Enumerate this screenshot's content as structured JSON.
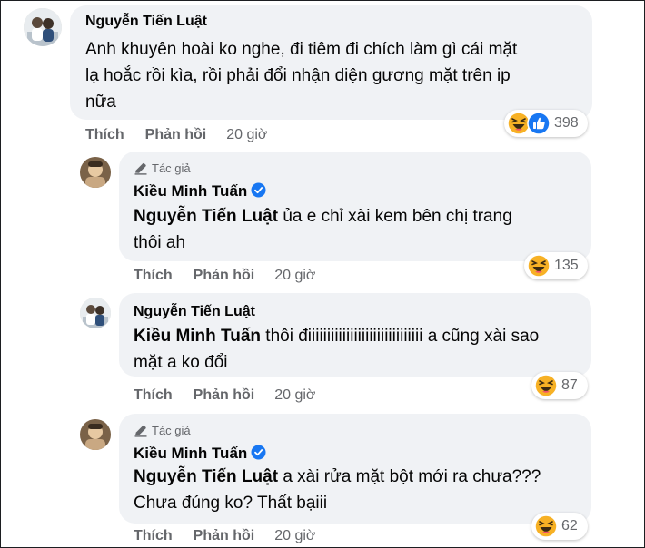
{
  "comments": [
    {
      "author": "Nguyễn Tiến Luật",
      "author_badge": "",
      "verified": false,
      "mention": "",
      "lines": [
        "Anh khuyên hoài ko nghe, đi tiêm đi chích làm gì cái mặt",
        "lạ hoắc rồi kìa, rồi phải đổi nhận diện gương mặt trên ip",
        "nữa"
      ],
      "reactions": [
        "haha-icon",
        "like-icon"
      ],
      "reaction_count": "398",
      "actions": {
        "like": "Thích",
        "reply": "Phản hồi",
        "time": "20 giờ"
      }
    },
    {
      "author": "Kiều Minh Tuấn",
      "author_badge": "Tác giả",
      "verified": true,
      "mention": "Nguyễn Tiến Luật",
      "lines": [
        " ủa e chỉ xài kem bên chị trang",
        "thôi ah"
      ],
      "reactions": [
        "haha-icon"
      ],
      "reaction_count": "135",
      "actions": {
        "like": "Thích",
        "reply": "Phản hồi",
        "time": "20 giờ"
      }
    },
    {
      "author": "Nguyễn Tiến Luật",
      "author_badge": "",
      "verified": false,
      "mention": "Kiều Minh Tuấn",
      "lines": [
        " thôi điiiiiiiiiiiiiiiiiiiiiiiiiiiiii a cũng xài sao",
        "mặt a ko đổi"
      ],
      "reactions": [
        "haha-icon"
      ],
      "reaction_count": "87",
      "actions": {
        "like": "Thích",
        "reply": "Phản hồi",
        "time": "20 giờ"
      }
    },
    {
      "author": "Kiều Minh Tuấn",
      "author_badge": "Tác giả",
      "verified": true,
      "mention": "Nguyễn Tiến Luật",
      "lines": [
        " a xài rửa mặt bột mới ra chưa???",
        "Chưa đúng ko? Thất bạiii"
      ],
      "reactions": [
        "haha-icon"
      ],
      "reaction_count": "62",
      "actions": {
        "like": "Thích",
        "reply": "Phản hồi",
        "time": "20 giờ"
      }
    }
  ],
  "colors": {
    "bubble": "#f0f2f5",
    "secondary_text": "#65676b",
    "verified_blue": "#1877f2",
    "like_blue": "#1877f2",
    "haha_yellow": "#f7b125"
  }
}
